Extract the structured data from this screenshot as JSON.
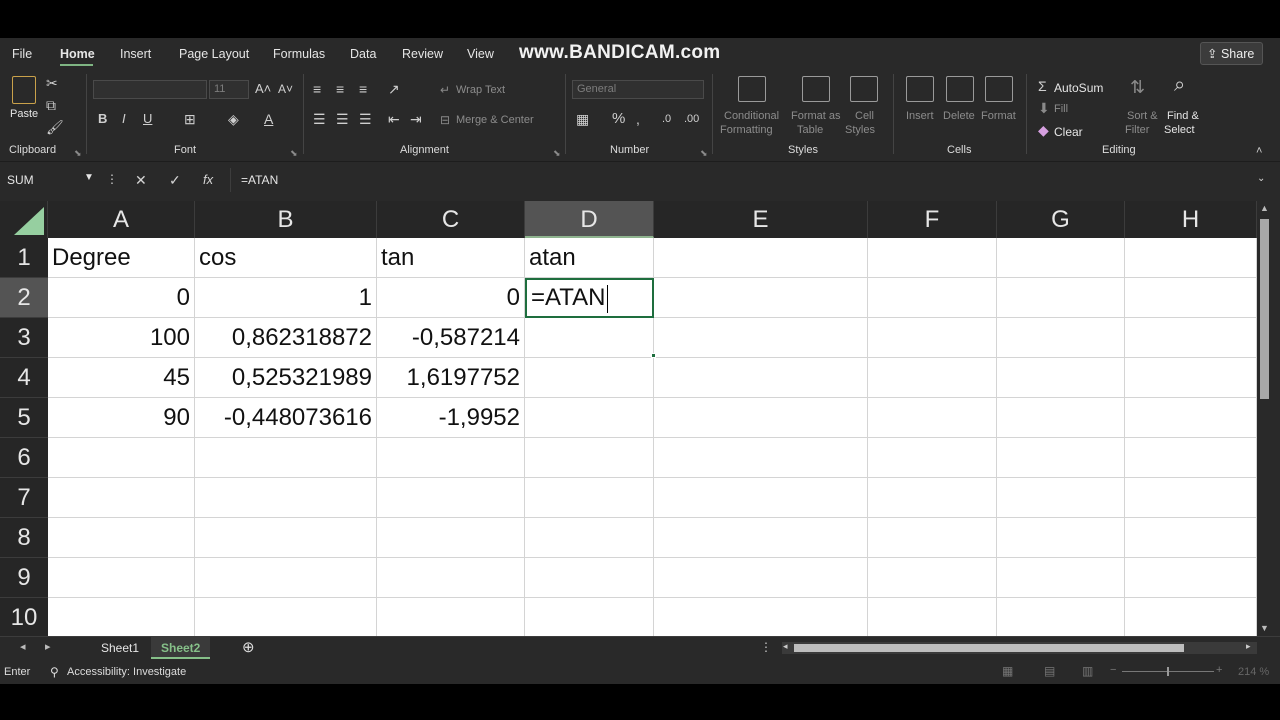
{
  "watermark": "www.BANDICAM.com",
  "tabs": [
    "File",
    "Home",
    "Insert",
    "Page Layout",
    "Formulas",
    "Data",
    "Review",
    "View"
  ],
  "share_label": "Share",
  "ribbon": {
    "clipboard": {
      "label": "Clipboard",
      "paste": "Paste"
    },
    "font": {
      "label": "Font",
      "name": "",
      "size": "11",
      "bold": "B",
      "italic": "I",
      "underline": "U"
    },
    "alignment": {
      "label": "Alignment",
      "wrap_text": "Wrap Text",
      "merge_center": "Merge & Center"
    },
    "number": {
      "label": "Number",
      "format": "General",
      "percent": "%"
    },
    "styles": {
      "label": "Styles",
      "conditional": [
        "Conditional",
        "Formatting"
      ],
      "format_table": [
        "Format as",
        "Table"
      ],
      "cell_styles": [
        "Cell",
        "Styles"
      ]
    },
    "cells": {
      "label": "Cells",
      "insert": "Insert",
      "delete": "Delete",
      "format": "Format"
    },
    "editing": {
      "label": "Editing",
      "autosum": "AutoSum",
      "fill": "Fill",
      "clear": "Clear",
      "sort_filter": [
        "Sort &",
        "Filter"
      ],
      "find_select": [
        "Find &",
        "Select"
      ]
    }
  },
  "formula_bar": {
    "name_box": "SUM",
    "fx": "fx",
    "formula": "=ATAN"
  },
  "columns": [
    "A",
    "B",
    "C",
    "D",
    "E",
    "F",
    "G",
    "H"
  ],
  "rows": [
    "1",
    "2",
    "3",
    "4",
    "5",
    "6",
    "7",
    "8",
    "9",
    "10"
  ],
  "cells": {
    "r1": [
      "Degree",
      "cos",
      "tan",
      "atan"
    ],
    "r2": [
      "0",
      "1",
      "0",
      "=ATAN"
    ],
    "r3": [
      "100",
      "0,862318872",
      "-0,587214",
      ""
    ],
    "r4": [
      "45",
      "0,525321989",
      "1,6197752",
      ""
    ],
    "r5": [
      "90",
      "-0,448073616",
      "-1,9952",
      ""
    ]
  },
  "sheets": [
    "Sheet1",
    "Sheet2"
  ],
  "status": {
    "mode": "Enter",
    "accessibility": "Accessibility: Investigate",
    "zoom": "214 %"
  }
}
